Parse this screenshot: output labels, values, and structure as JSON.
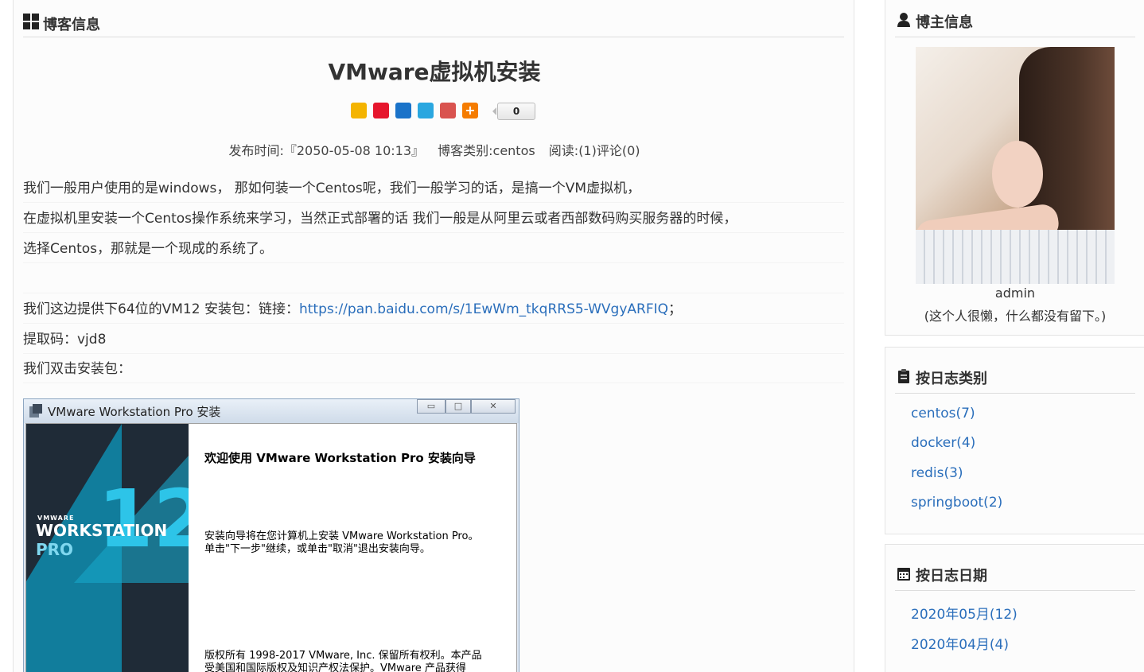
{
  "main": {
    "section_title": "博客信息",
    "article_title": "VMware虚拟机安装",
    "share_count": "0",
    "share_icons": [
      "qzone-icon",
      "weibo-icon",
      "renren-icon",
      "tqq-icon",
      "tieba-icon",
      "more-share-icon"
    ],
    "meta": {
      "publish": "发布时间:『2050-05-08 10:13』",
      "category": "博客类别:centos",
      "stats": "阅读:(1)评论(0)"
    },
    "paragraphs": [
      "我们一般用户使用的是windows， 那如何装一个Centos呢，我们一般学习的话，是搞一个VM虚拟机，",
      "在虚拟机里安装一个Centos操作系统来学习，当然正式部署的话 我们一般是从阿里云或者西部数码购买服务器的时候，",
      "选择Centos，那就是一个现成的系统了。",
      ""
    ],
    "link_line": {
      "prefix": "我们这边提供下64位的VM12 安装包：链接：",
      "url": "https://pan.baidu.com/s/1EwWm_tkqRRS5-WVgyARFIQ",
      "suffix": "；"
    },
    "code_line": "提取码：vjd8",
    "double_click_line": "我们双击安装包："
  },
  "installer": {
    "window_title": "VMware Workstation Pro 安装",
    "btn_min": "▭",
    "btn_max": "□",
    "btn_close": "✕",
    "brand_small": "VMWARE",
    "brand_main": "WORKSTATION",
    "brand_pro": "PRO",
    "brand_num": "12",
    "heading": "欢迎使用 VMware Workstation Pro 安装向导",
    "text1": "安装向导将在您计算机上安装 VMware Workstation Pro。",
    "text2": "单击\"下一步\"继续，或单击\"取消\"退出安装向导。",
    "copyright1": "版权所有 1998-2017 VMware, Inc. 保留所有权利。本产品",
    "copyright2": "受美国和国际版权及知识产权法保护。VMware 产品获得"
  },
  "sidebar": {
    "owner": {
      "title": "博主信息",
      "name": "admin",
      "description": "(这个人很懒，什么都没有留下。)"
    },
    "categories": {
      "title": "按日志类别",
      "items": [
        "centos(7)",
        "docker(4)",
        "redis(3)",
        "springboot(2)"
      ]
    },
    "dates": {
      "title": "按日志日期",
      "items": [
        "2020年05月(12)",
        "2020年04月(4)"
      ]
    }
  }
}
